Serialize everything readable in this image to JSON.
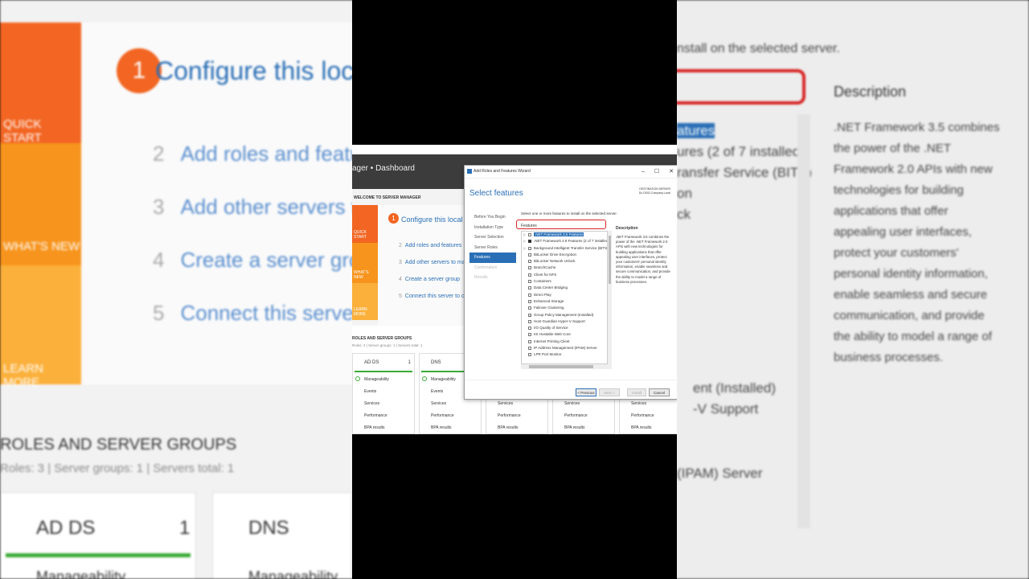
{
  "background": {
    "tiles": {
      "quick_start": "QUICK START",
      "whats_new": "WHAT'S NEW",
      "learn_more": "LEARN MORE"
    },
    "steps": {
      "step1_num": "1",
      "step1": "Configure this local ser",
      "step2_num": "2",
      "step2": "Add roles and features",
      "step3_num": "3",
      "step3": "Add other servers to man",
      "step4_num": "4",
      "step4": "Create a server group",
      "step5_num": "5",
      "step5": "Connect this server to clo"
    },
    "rsg_title": "ROLES AND SERVER GROUPS",
    "rsg_sub": "Roles: 3   |   Server groups: 1   |   Servers total: 1",
    "cards": [
      {
        "title": "AD DS",
        "count": "1",
        "row": "Manageability"
      },
      {
        "title": "DNS",
        "row": "Manageability"
      }
    ],
    "right": {
      "instruction": "nstall on the selected server.",
      "list": [
        "atures",
        "ures (2 of 7 installed)",
        "ransfer Service (BITS)",
        "on",
        "ck"
      ],
      "list_lower": [
        "ent (Installed)",
        "-V Support",
        "(IPAM) Server"
      ],
      "desc_title": "Description",
      "desc": ".NET Framework 3.5 combines the power of the .NET Framework 2.0 APIs with new technologies for building applications that offer appealing user interfaces, protect your customers' personal identity information, enable seamless and secure communication, and provide the ability to model a range of business processes."
    }
  },
  "server_manager": {
    "title": "ager • Dashboard",
    "welcome": "WELCOME TO SERVER MANAGER",
    "tiles": {
      "quick_start": "QUICK START",
      "whats_new": "WHAT'S NEW",
      "learn_more": "LEARN MORE"
    },
    "steps": {
      "step1_num": "1",
      "step1": "Configure this local serv",
      "step2_num": "2",
      "step2": "Add roles and features",
      "step3_num": "3",
      "step3": "Add other servers to mana",
      "step4_num": "4",
      "step4": "Create a server group",
      "step5_num": "5",
      "step5": "Connect this server to clou"
    },
    "rsg_title": "ROLES AND SERVER GROUPS",
    "rsg_sub": "Roles: 3  |  Server groups: 1  |  Servers total: 1",
    "card_rows": [
      "Manageability",
      "Events",
      "Services",
      "Performance",
      "BPA results"
    ],
    "cards": [
      {
        "title": "AD DS",
        "count": "1"
      },
      {
        "title": "DNS",
        "count": ""
      },
      {
        "title": "",
        "count": ""
      },
      {
        "title": "",
        "count": ""
      },
      {
        "title": "",
        "count": ""
      }
    ]
  },
  "wizard": {
    "window_title": "Add Roles and Features Wizard",
    "minimize": "–",
    "maximize": "☐",
    "close": "✕",
    "heading": "Select features",
    "dest_label": "DESTINATION SERVER",
    "dest_server": "Dc-DS02.Company.Local",
    "nav": [
      {
        "label": "Before You Begin",
        "state": "normal"
      },
      {
        "label": "Installation Type",
        "state": "normal"
      },
      {
        "label": "Server Selection",
        "state": "normal"
      },
      {
        "label": "Server Roles",
        "state": "normal"
      },
      {
        "label": "Features",
        "state": "active"
      },
      {
        "label": "Confirmation",
        "state": "dim"
      },
      {
        "label": "Results",
        "state": "dim"
      }
    ],
    "instruction": "Select one or more features to install on the selected server.",
    "features_header": "Features",
    "features": [
      {
        "label": ".NET Framework 3.5 Features",
        "exp": "▷",
        "cb": "empty",
        "sel": true
      },
      {
        "label": ".NET Framework 4.8 Features (2 of 7 installed)",
        "exp": "▷",
        "cb": "partial",
        "sel": false
      },
      {
        "label": "Background Intelligent Transfer Service (BITS)",
        "exp": "▷",
        "cb": "empty",
        "sel": false
      },
      {
        "label": "BitLocker Drive Encryption",
        "exp": "",
        "cb": "empty",
        "sel": false
      },
      {
        "label": "BitLocker Network Unlock",
        "exp": "",
        "cb": "empty",
        "sel": false
      },
      {
        "label": "BranchCache",
        "exp": "",
        "cb": "empty",
        "sel": false
      },
      {
        "label": "Client for NFS",
        "exp": "",
        "cb": "empty",
        "sel": false
      },
      {
        "label": "Containers",
        "exp": "",
        "cb": "empty",
        "sel": false
      },
      {
        "label": "Data Center Bridging",
        "exp": "",
        "cb": "empty",
        "sel": false
      },
      {
        "label": "Direct Play",
        "exp": "",
        "cb": "empty",
        "sel": false
      },
      {
        "label": "Enhanced Storage",
        "exp": "",
        "cb": "empty",
        "sel": false
      },
      {
        "label": "Failover Clustering",
        "exp": "",
        "cb": "empty",
        "sel": false
      },
      {
        "label": "Group Policy Management (Installed)",
        "exp": "",
        "cb": "checked",
        "sel": false
      },
      {
        "label": "Host Guardian Hyper-V Support",
        "exp": "",
        "cb": "empty",
        "sel": false
      },
      {
        "label": "I/O Quality of Service",
        "exp": "",
        "cb": "empty",
        "sel": false
      },
      {
        "label": "IIS Hostable Web Core",
        "exp": "",
        "cb": "empty",
        "sel": false
      },
      {
        "label": "Internet Printing Client",
        "exp": "",
        "cb": "empty",
        "sel": false
      },
      {
        "label": "IP Address Management (IPAM) Server",
        "exp": "",
        "cb": "empty",
        "sel": false
      },
      {
        "label": "LPR Port Monitor",
        "exp": "",
        "cb": "empty",
        "sel": false
      }
    ],
    "description_title": "Description",
    "description": ".NET Framework 3.5 combines the power of the .NET Framework 2.0 APIs with new technologies for building applications that offer appealing user interfaces, protect your customers' personal identity information, enable seamless and secure communication, and provide the ability to model a range of business processes.",
    "buttons": {
      "previous": "< Previous",
      "next": "Next >",
      "install": "Install",
      "cancel": "Cancel"
    }
  },
  "colors": {
    "accent": "#2a6fb6",
    "quick_start": "#f26522",
    "whats_new": "#f7941d",
    "learn_more": "#fbb03b",
    "highlight_box": "#d62222",
    "ok": "#3aaa35"
  }
}
